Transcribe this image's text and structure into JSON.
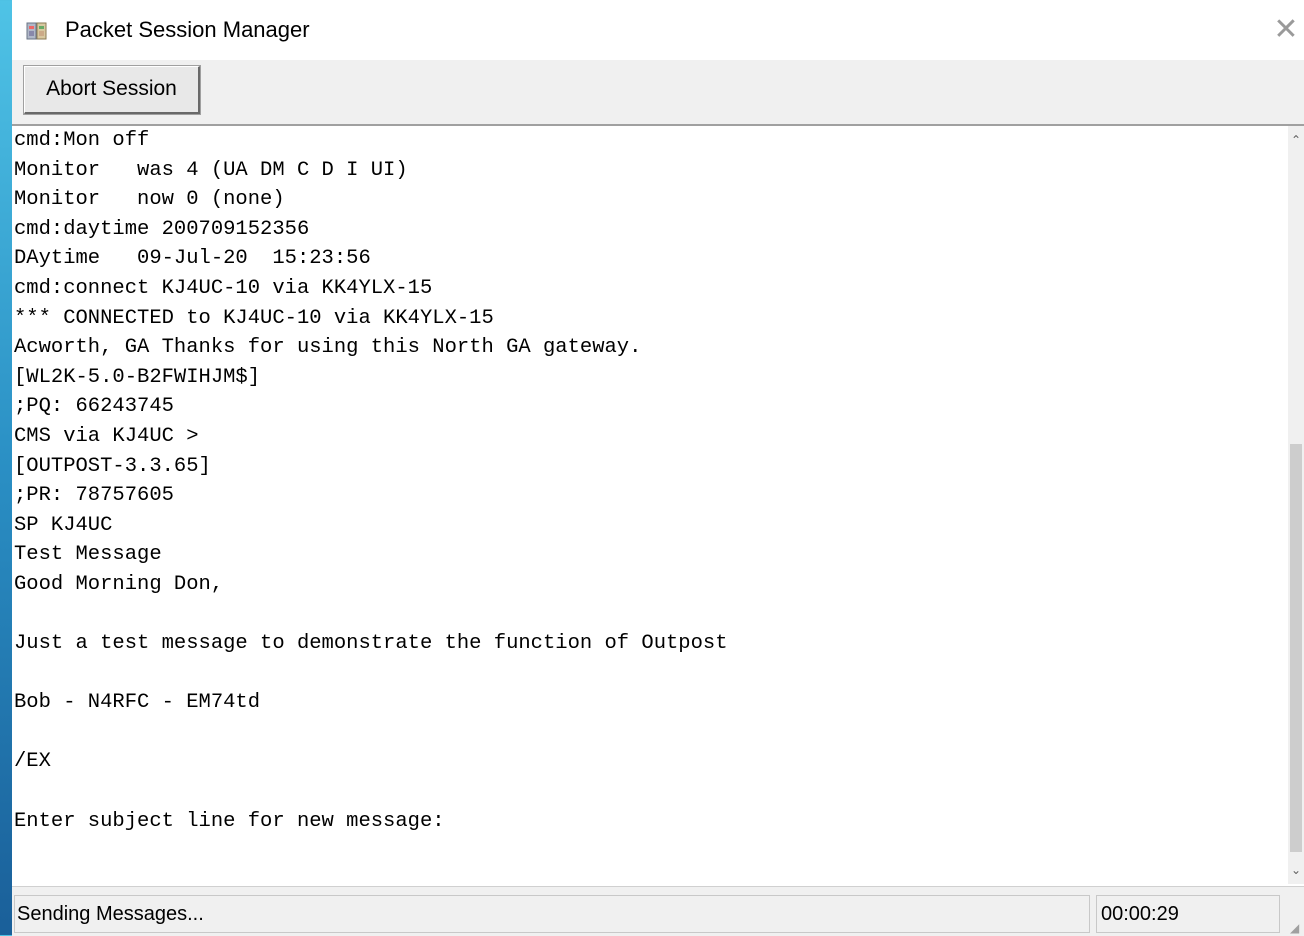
{
  "window": {
    "title": "Packet Session Manager",
    "close_glyph": "✕"
  },
  "toolbar": {
    "abort_label": "Abort Session"
  },
  "terminal": {
    "lines": [
      "cmd:Mon off",
      "Monitor   was 4 (UA DM C D I UI)",
      "Monitor   now 0 (none)",
      "cmd:daytime 200709152356",
      "DAytime   09-Jul-20  15:23:56",
      "cmd:connect KJ4UC-10 via KK4YLX-15",
      "*** CONNECTED to KJ4UC-10 via KK4YLX-15",
      "Acworth, GA Thanks for using this North GA gateway.",
      "[WL2K-5.0-B2FWIHJM$]",
      ";PQ: 66243745",
      "CMS via KJ4UC >",
      "[OUTPOST-3.3.65]",
      ";PR: 78757605",
      "SP KJ4UC",
      "Test Message",
      "Good Morning Don,",
      "",
      "Just a test message to demonstrate the function of Outpost",
      "",
      "Bob - N4RFC - EM74td",
      "",
      "/EX",
      "",
      "Enter subject line for new message:"
    ]
  },
  "statusbar": {
    "message": "Sending Messages...",
    "timer": "00:00:29"
  },
  "icons": {
    "app": "app-icon",
    "close": "close-icon",
    "scroll_up": "chevron-up-icon",
    "scroll_down": "chevron-down-icon"
  }
}
